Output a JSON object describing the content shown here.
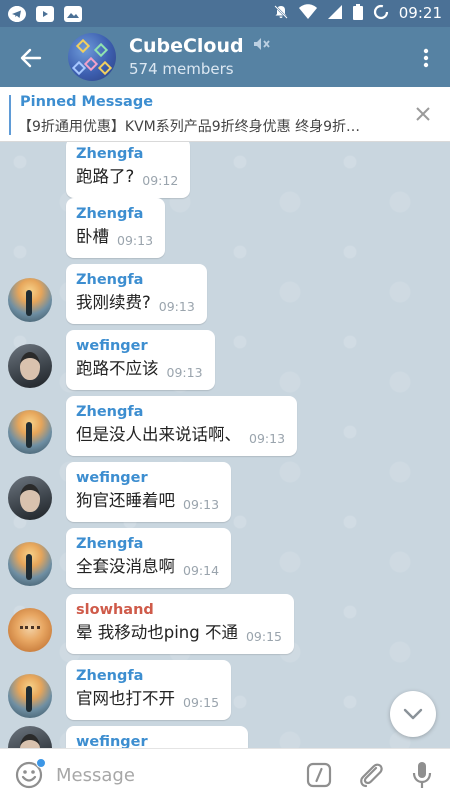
{
  "status_bar": {
    "left_icons": [
      "telegram-icon",
      "youtube-icon",
      "image-icon"
    ],
    "right_icons": [
      "mute-notification-icon",
      "wifi-icon",
      "signal-icon",
      "battery-icon",
      "sync-icon"
    ],
    "time": "09:21"
  },
  "header": {
    "title": "CubeCloud",
    "subtitle": "574 members",
    "muted": true
  },
  "pinned": {
    "title": "Pinned Message",
    "text": "【9折通用优惠】KVM系列产品9折终身优惠 终身9折…"
  },
  "messages": [
    {
      "sender": "Zhengfa",
      "text": "跑路了?",
      "time": "09:12",
      "avatar": false
    },
    {
      "sender": "Zhengfa",
      "text": "卧槽",
      "time": "09:13",
      "avatar": false
    },
    {
      "sender": "Zhengfa",
      "text": "我刚续费?",
      "time": "09:13",
      "avatar": true
    },
    {
      "sender": "wefinger",
      "text": "跑路不应该",
      "time": "09:13",
      "avatar": true
    },
    {
      "sender": "Zhengfa",
      "text": "但是没人出来说话啊、",
      "time": "09:13",
      "avatar": true
    },
    {
      "sender": "wefinger",
      "text": "狗官还睡着吧",
      "time": "09:13",
      "avatar": true
    },
    {
      "sender": "Zhengfa",
      "text": "全套没消息啊",
      "time": "09:14",
      "avatar": true
    },
    {
      "sender": "slowhand",
      "text": "晕 我移动也ping 不通",
      "time": "09:15",
      "avatar": true
    },
    {
      "sender": "Zhengfa",
      "text": "官网也打不开",
      "time": "09:15",
      "avatar": true
    },
    {
      "sender": "wefinger",
      "text": "",
      "time": "",
      "avatar": true
    }
  ],
  "input": {
    "placeholder": "Message"
  },
  "colors": {
    "header": "#5682a3",
    "status_bar": "#4b7196",
    "accent": "#3d8ed0",
    "slowhand": "#cf5b4a",
    "chat_bg": "#c9d6df"
  }
}
